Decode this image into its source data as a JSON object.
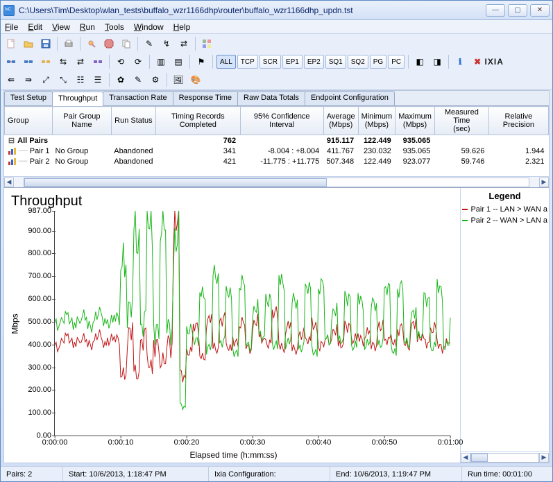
{
  "window": {
    "title": "C:\\Users\\Tim\\Desktop\\wlan_tests\\buffalo_wzr1166dhp\\router\\buffalo_wzr1166dhp_updn.tst"
  },
  "menu": [
    "File",
    "Edit",
    "View",
    "Run",
    "Tools",
    "Window",
    "Help"
  ],
  "toolbar2_pills": [
    "ALL",
    "TCP",
    "SCR",
    "EP1",
    "EP2",
    "SQ1",
    "SQ2",
    "PG",
    "PC"
  ],
  "brand": "IXIA",
  "tabs": [
    "Test Setup",
    "Throughput",
    "Transaction Rate",
    "Response Time",
    "Raw Data Totals",
    "Endpoint Configuration"
  ],
  "active_tab_index": 1,
  "table": {
    "columns": [
      "Group",
      "Pair Group Name",
      "Run Status",
      "Timing Records Completed",
      "95% Confidence Interval",
      "Average (Mbps)",
      "Minimum (Mbps)",
      "Maximum (Mbps)",
      "Measured Time (sec)",
      "Relative Precision"
    ],
    "rows": [
      {
        "type": "summary",
        "group": "All Pairs",
        "pair_group": "",
        "run_status": "",
        "timing": "762",
        "ci": "",
        "avg": "915.117",
        "min": "122.449",
        "max": "935.065",
        "mtime": "",
        "prec": ""
      },
      {
        "type": "row",
        "group": "Pair 1",
        "pair_group": "No Group",
        "run_status": "Abandoned",
        "timing": "341",
        "ci": "-8.004 : +8.004",
        "avg": "411.767",
        "min": "230.032",
        "max": "935.065",
        "mtime": "59.626",
        "prec": "1.944"
      },
      {
        "type": "row",
        "group": "Pair 2",
        "pair_group": "No Group",
        "run_status": "Abandoned",
        "timing": "421",
        "ci": "-11.775 : +11.775",
        "avg": "507.348",
        "min": "122.449",
        "max": "923.077",
        "mtime": "59.746",
        "prec": "2.321"
      }
    ]
  },
  "chart": {
    "title": "Throughput",
    "ylabel": "Mbps",
    "xlabel": "Elapsed time (h:mm:ss)",
    "legend_title": "Legend",
    "legend": [
      {
        "name": "Pair 1 -- LAN > WAN a",
        "color": "#c01414"
      },
      {
        "name": "Pair 2 -- WAN > LAN a",
        "color": "#15b515"
      }
    ]
  },
  "chart_data": {
    "type": "line",
    "xlabel": "Elapsed time (h:mm:ss)",
    "ylabel": "Mbps",
    "ylim": [
      0,
      987
    ],
    "yticks": [
      0,
      100,
      200,
      300,
      400,
      500,
      600,
      700,
      800,
      900,
      987
    ],
    "xticks": [
      "0:00:00",
      "0:00:10",
      "0:00:20",
      "0:00:30",
      "0:00:40",
      "0:00:50",
      "0:01:00"
    ],
    "xlim_seconds": [
      0,
      60
    ],
    "series": [
      {
        "name": "Pair 1 -- LAN > WAN a",
        "color": "#c01414",
        "x": [
          0,
          1,
          2,
          3,
          4,
          5,
          6,
          7,
          8,
          9,
          10,
          11,
          12,
          13,
          14,
          15,
          16,
          17,
          18,
          19,
          20,
          21,
          22,
          23,
          24,
          25,
          26,
          27,
          28,
          29,
          30,
          31,
          32,
          33,
          34,
          35,
          36,
          37,
          38,
          39,
          40,
          41,
          42,
          43,
          44,
          45,
          46,
          47,
          48,
          49,
          50,
          51,
          52,
          53,
          54,
          55,
          56,
          57,
          58,
          59,
          60
        ],
        "y": [
          400,
          420,
          410,
          430,
          410,
          415,
          425,
          405,
          430,
          410,
          300,
          420,
          280,
          430,
          290,
          440,
          300,
          430,
          935,
          250,
          380,
          460,
          360,
          500,
          380,
          520,
          370,
          430,
          480,
          390,
          500,
          410,
          420,
          520,
          400,
          480,
          370,
          460,
          400,
          500,
          390,
          420,
          470,
          380,
          500,
          410,
          430,
          460,
          380,
          500,
          400,
          420,
          470,
          390,
          510,
          410,
          420,
          460,
          390,
          420,
          410
        ]
      },
      {
        "name": "Pair 2 -- WAN > LAN a",
        "color": "#15b515",
        "x": [
          0,
          1,
          2,
          3,
          4,
          5,
          6,
          7,
          8,
          9,
          10,
          11,
          12,
          13,
          14,
          15,
          16,
          17,
          18,
          19,
          20,
          21,
          22,
          23,
          24,
          25,
          26,
          27,
          28,
          29,
          30,
          31,
          32,
          33,
          34,
          35,
          36,
          37,
          38,
          39,
          40,
          41,
          42,
          43,
          44,
          45,
          46,
          47,
          48,
          49,
          50,
          51,
          52,
          53,
          54,
          55,
          56,
          57,
          58,
          59,
          60
        ],
        "y": [
          500,
          510,
          495,
          520,
          505,
          500,
          515,
          505,
          510,
          500,
          850,
          520,
          900,
          500,
          880,
          510,
          860,
          500,
          840,
          122,
          480,
          400,
          650,
          380,
          700,
          420,
          600,
          380,
          650,
          400,
          560,
          420,
          620,
          380,
          700,
          410,
          580,
          400,
          620,
          380,
          650,
          420,
          560,
          400,
          630,
          380,
          600,
          410,
          560,
          420,
          620,
          380,
          650,
          400,
          560,
          420,
          620,
          380,
          640,
          410,
          520
        ]
      }
    ]
  },
  "status": {
    "pairs": "Pairs: 2",
    "start": "Start: 10/6/2013, 1:18:47 PM",
    "config": "Ixia Configuration:",
    "end": "End: 10/6/2013, 1:19:47 PM",
    "runtime": "Run time: 00:01:00"
  }
}
